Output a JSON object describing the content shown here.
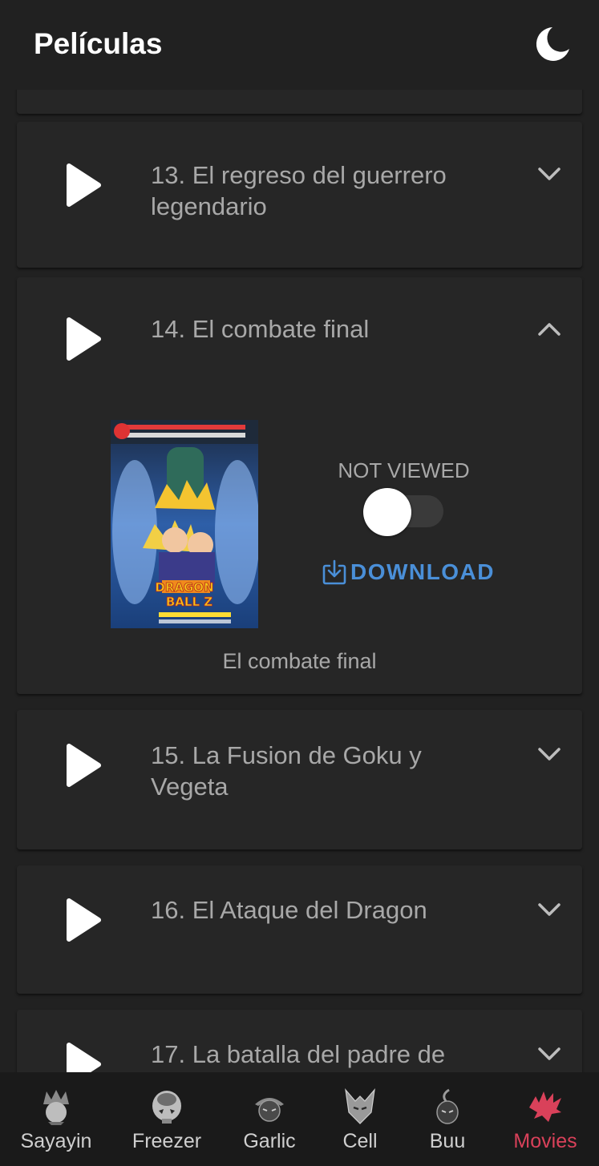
{
  "app": {
    "title": "Películas"
  },
  "colors": {
    "background": "#212121",
    "card": "#262626",
    "muted_text": "#a8a8a8",
    "accent_blue": "#4a8fd8",
    "accent_red": "#d9415a"
  },
  "movies": [
    {
      "title": "13. El regreso del guerrero legendario",
      "expanded": false
    },
    {
      "title": "14. El combate final",
      "expanded": true,
      "status_label": "NOT VIEWED",
      "viewed": false,
      "download_label": "DOWNLOAD",
      "poster_logo_line1": "DRAGON",
      "poster_logo_line2": "BALL Z",
      "caption": "El combate final"
    },
    {
      "title": "15. La Fusion de Goku y Vegeta",
      "expanded": false
    },
    {
      "title": "16. El Ataque del Dragon",
      "expanded": false
    },
    {
      "title": "17. La batalla del padre de",
      "expanded": false
    }
  ],
  "bottom_nav": [
    {
      "label": "Sayayin",
      "icon": "saiyan-icon",
      "active": false
    },
    {
      "label": "Freezer",
      "icon": "freezer-icon",
      "active": false
    },
    {
      "label": "Garlic",
      "icon": "garlic-icon",
      "active": false
    },
    {
      "label": "Cell",
      "icon": "cell-icon",
      "active": false
    },
    {
      "label": "Buu",
      "icon": "buu-icon",
      "active": false
    },
    {
      "label": "Movies",
      "icon": "movies-icon",
      "active": true
    }
  ]
}
